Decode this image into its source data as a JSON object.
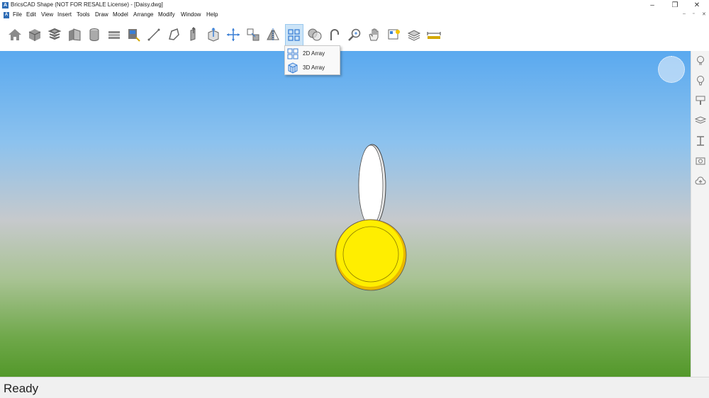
{
  "window": {
    "title": "BricsCAD Shape (NOT FOR RESALE License) - [Daisy.dwg]",
    "minimize": "–",
    "restore": "❐",
    "close": "✕"
  },
  "menu": {
    "items": [
      {
        "name": "menu-file",
        "label": "File"
      },
      {
        "name": "menu-edit",
        "label": "Edit"
      },
      {
        "name": "menu-view",
        "label": "View"
      },
      {
        "name": "menu-insert",
        "label": "Insert"
      },
      {
        "name": "menu-tools",
        "label": "Tools"
      },
      {
        "name": "menu-draw",
        "label": "Draw"
      },
      {
        "name": "menu-model",
        "label": "Model"
      },
      {
        "name": "menu-arrange",
        "label": "Arrange"
      },
      {
        "name": "menu-modify",
        "label": "Modify"
      },
      {
        "name": "menu-window",
        "label": "Window"
      },
      {
        "name": "menu-help",
        "label": "Help"
      }
    ],
    "doc_controls": [
      "–",
      "▫",
      "✕"
    ]
  },
  "toolbar": {
    "icons": [
      "home-icon",
      "box-icon",
      "stack-icon",
      "wall-icon",
      "cylinder-icon",
      "slab-icon",
      "window-tool-icon",
      "line-icon",
      "polyline-icon",
      "extrude-icon",
      "pushpull-icon",
      "move-icon",
      "copy-icon",
      "mirror-icon",
      "array-icon",
      "boolean-icon",
      "fillet-icon",
      "zoom-icon",
      "pan-icon",
      "lights-icon",
      "materials-icon",
      "measure-icon"
    ]
  },
  "dropdown": {
    "items": [
      {
        "label": "2D Array",
        "icon": "array-2d-icon"
      },
      {
        "label": "3D Array",
        "icon": "array-3d-icon"
      }
    ]
  },
  "right_panel": {
    "icons": [
      "lightbulb-icon",
      "materials-panel-icon",
      "paint-icon",
      "layers-icon",
      "section-icon",
      "camera-icon",
      "cloud-icon"
    ]
  },
  "status": {
    "text": "Ready"
  },
  "colors": {
    "accent": "#2f6db5",
    "sky_top": "#5aa9ef",
    "ground": "#53982a",
    "flower_center": "#ffee00",
    "petal": "#ffffff"
  }
}
